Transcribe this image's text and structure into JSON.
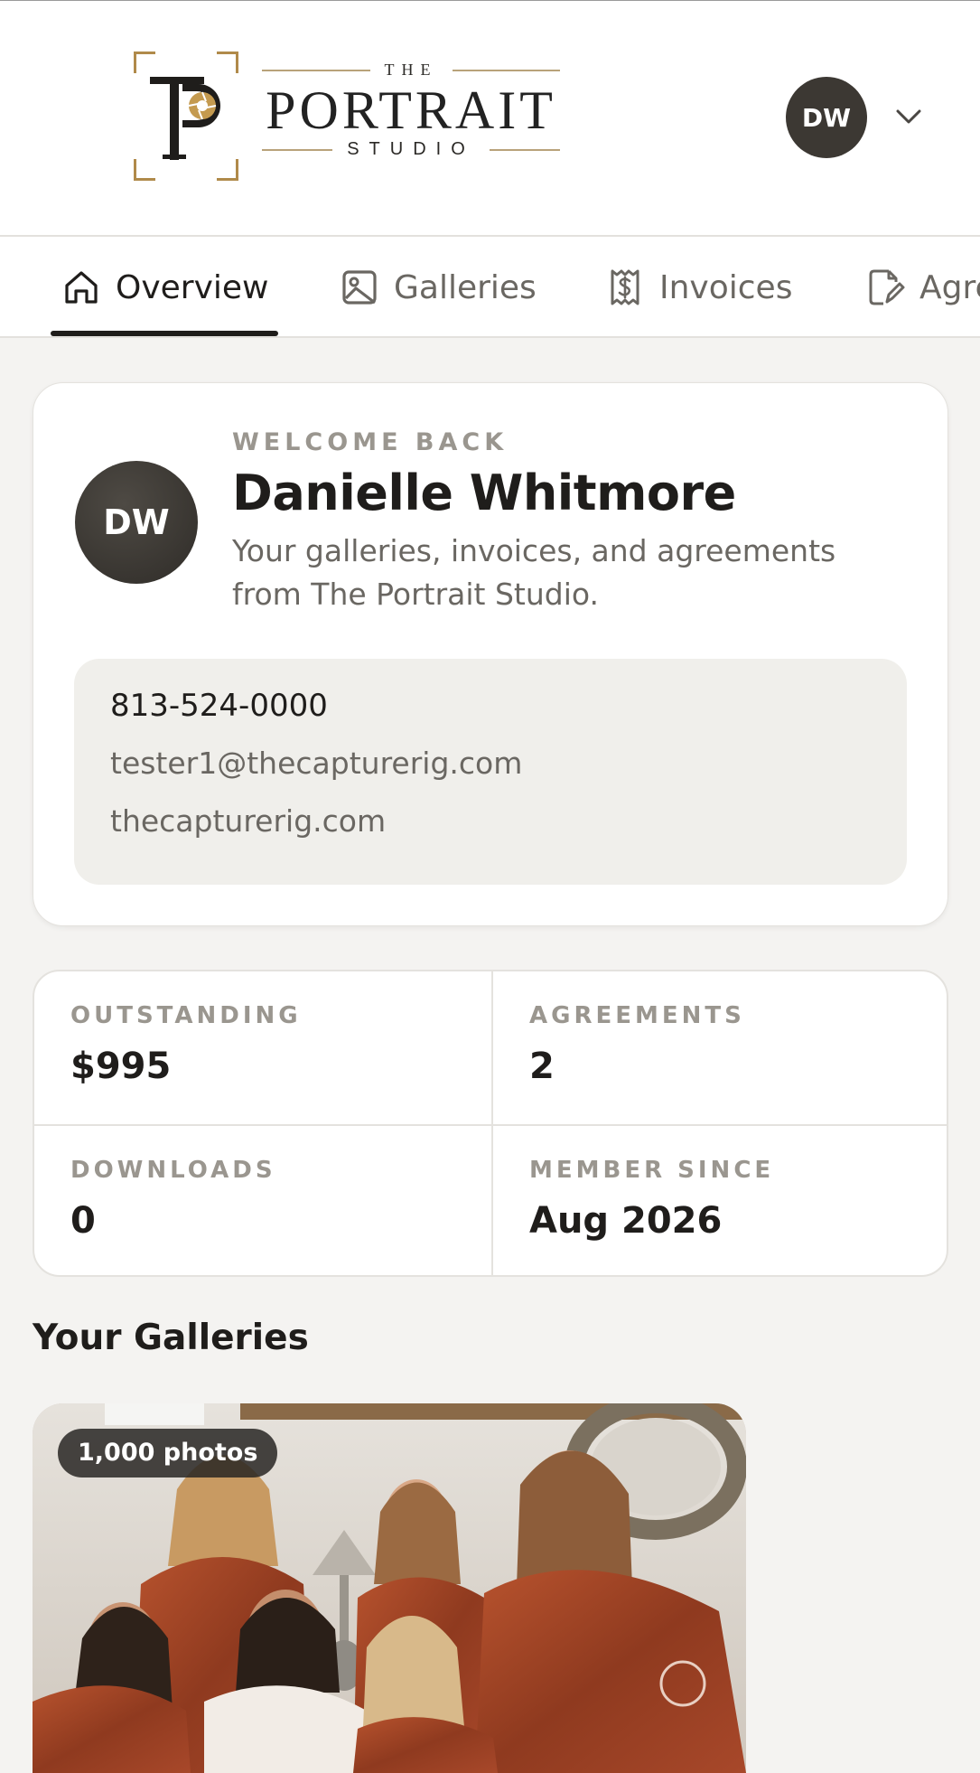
{
  "brand": {
    "logo_the": "THE",
    "logo_name": "PORTRAIT",
    "logo_studio": "STUDIO",
    "accent_gold": "#b08a4a"
  },
  "header": {
    "avatar_initials": "DW",
    "menu_icon": "chevron-down-icon"
  },
  "tabs": [
    {
      "label": "Overview",
      "icon": "home-icon",
      "active": true
    },
    {
      "label": "Galleries",
      "icon": "image-icon",
      "active": false
    },
    {
      "label": "Invoices",
      "icon": "receipt-dollar-icon",
      "active": false
    },
    {
      "label": "Agre",
      "icon": "document-edit-icon",
      "active": false
    }
  ],
  "welcome": {
    "eyebrow": "WELCOME BACK",
    "name": "Danielle Whitmore",
    "avatar_initials": "DW",
    "subtitle": "Your galleries, invoices, and agreements from The Portrait Studio.",
    "phone": "813-524-0000",
    "email": "tester1@thecapturerig.com",
    "website": "thecapturerig.com"
  },
  "stats": [
    {
      "label": "OUTSTANDING",
      "value": "$995"
    },
    {
      "label": "AGREEMENTS",
      "value": "2"
    },
    {
      "label": "DOWNLOADS",
      "value": "0"
    },
    {
      "label": "MEMBER SINCE",
      "value": "Aug 2026"
    }
  ],
  "galleries": {
    "section_title": "Your Galleries",
    "items": [
      {
        "photo_count": "1,000 photos"
      }
    ]
  }
}
